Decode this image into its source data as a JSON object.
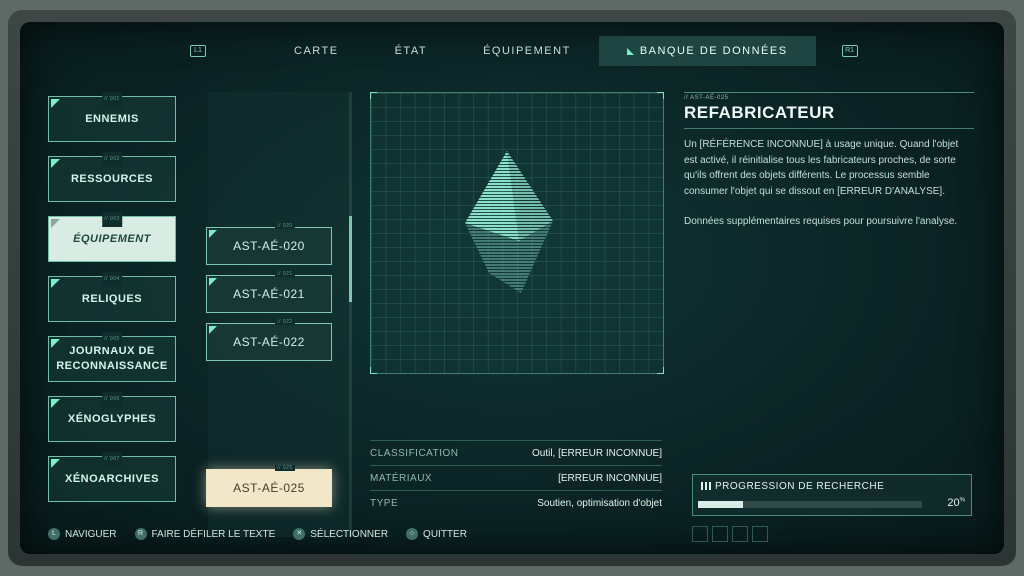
{
  "tabs": {
    "left_bumper": "L1",
    "right_bumper": "R1",
    "items": [
      "CARTE",
      "ÉTAT",
      "ÉQUIPEMENT",
      "BANQUE DE DONNÉES"
    ],
    "active_index": 3
  },
  "categories": [
    {
      "num": "// 001",
      "label": "ENNEMIS"
    },
    {
      "num": "// 002",
      "label": "RESSOURCES"
    },
    {
      "num": "// 003",
      "label": "ÉQUIPEMENT"
    },
    {
      "num": "// 004",
      "label": "RELIQUES"
    },
    {
      "num": "// 005",
      "label": "JOURNAUX DE RECONNAISSANCE"
    },
    {
      "num": "// 006",
      "label": "XÉNOGLYPHES"
    },
    {
      "num": "// 007",
      "label": "XÉNOARCHIVES"
    }
  ],
  "selected_category": "ÉQUIPEMENT",
  "items": [
    {
      "num": "// 020",
      "label": "AST-AÉ-020"
    },
    {
      "num": "// 021",
      "label": "AST-AÉ-021"
    },
    {
      "num": "// 022",
      "label": "AST-AÉ-022"
    },
    {
      "num": "// 025",
      "label": "AST-AÉ-025"
    }
  ],
  "selected_item": "AST-AÉ-025",
  "detail": {
    "code": "// AST-AÉ-025",
    "title": "REFABRICATEUR",
    "description": "Un [RÉFÉRENCE INCONNUE] à usage unique. Quand l'objet est activé, il réinitialise tous les fabricateurs proches, de sorte qu'ils offrent des objets différents. Le processus semble consumer l'objet qui se dissout en [ERREUR D'ANALYSE].",
    "extra": "Données supplémentaires requises pour poursuivre l'analyse."
  },
  "stats": [
    {
      "key": "CLASSIFICATION",
      "value": "Outil, [ERREUR INCONNUE]"
    },
    {
      "key": "MATÉRIAUX",
      "value": "[ERREUR INCONNUE]"
    },
    {
      "key": "TYPE",
      "value": "Soutien, optimisation d'objet"
    }
  ],
  "progress": {
    "label": "PROGRESSION DE RECHERCHE",
    "percent": 20,
    "percent_text": "20",
    "unit": "%"
  },
  "footer": [
    {
      "glyph": "L",
      "label": "NAVIGUER"
    },
    {
      "glyph": "R",
      "label": "FAIRE DÉFILER LE TEXTE"
    },
    {
      "glyph": "✕",
      "label": "SÉLECTIONNER"
    },
    {
      "glyph": "○",
      "label": "QUITTER"
    }
  ],
  "colors": {
    "accent": "#7af0c6",
    "panel_bg": "#0b2425",
    "selected_item": "#f3e7c9"
  }
}
